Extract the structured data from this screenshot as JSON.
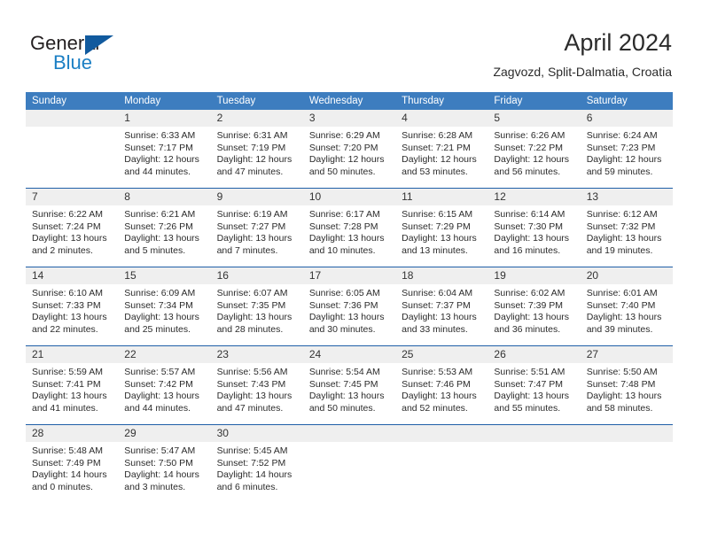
{
  "brand": {
    "name_part1": "General",
    "name_part2": "Blue",
    "accent_color": "#1b7fc4",
    "triangle_color": "#115a9e"
  },
  "header": {
    "title": "April 2024",
    "subtitle": "Zagvozd, Split-Dalmatia, Croatia"
  },
  "theme": {
    "header_bg": "#3d7dbf",
    "rule_color": "#1f5fa8",
    "datestrip_bg": "#efefef"
  },
  "weekdays": [
    "Sunday",
    "Monday",
    "Tuesday",
    "Wednesday",
    "Thursday",
    "Friday",
    "Saturday"
  ],
  "weeks": [
    {
      "days": [
        {
          "num": "",
          "lines": []
        },
        {
          "num": "1",
          "lines": [
            "Sunrise: 6:33 AM",
            "Sunset: 7:17 PM",
            "Daylight: 12 hours",
            "and 44 minutes."
          ]
        },
        {
          "num": "2",
          "lines": [
            "Sunrise: 6:31 AM",
            "Sunset: 7:19 PM",
            "Daylight: 12 hours",
            "and 47 minutes."
          ]
        },
        {
          "num": "3",
          "lines": [
            "Sunrise: 6:29 AM",
            "Sunset: 7:20 PM",
            "Daylight: 12 hours",
            "and 50 minutes."
          ]
        },
        {
          "num": "4",
          "lines": [
            "Sunrise: 6:28 AM",
            "Sunset: 7:21 PM",
            "Daylight: 12 hours",
            "and 53 minutes."
          ]
        },
        {
          "num": "5",
          "lines": [
            "Sunrise: 6:26 AM",
            "Sunset: 7:22 PM",
            "Daylight: 12 hours",
            "and 56 minutes."
          ]
        },
        {
          "num": "6",
          "lines": [
            "Sunrise: 6:24 AM",
            "Sunset: 7:23 PM",
            "Daylight: 12 hours",
            "and 59 minutes."
          ]
        }
      ]
    },
    {
      "days": [
        {
          "num": "7",
          "lines": [
            "Sunrise: 6:22 AM",
            "Sunset: 7:24 PM",
            "Daylight: 13 hours",
            "and 2 minutes."
          ]
        },
        {
          "num": "8",
          "lines": [
            "Sunrise: 6:21 AM",
            "Sunset: 7:26 PM",
            "Daylight: 13 hours",
            "and 5 minutes."
          ]
        },
        {
          "num": "9",
          "lines": [
            "Sunrise: 6:19 AM",
            "Sunset: 7:27 PM",
            "Daylight: 13 hours",
            "and 7 minutes."
          ]
        },
        {
          "num": "10",
          "lines": [
            "Sunrise: 6:17 AM",
            "Sunset: 7:28 PM",
            "Daylight: 13 hours",
            "and 10 minutes."
          ]
        },
        {
          "num": "11",
          "lines": [
            "Sunrise: 6:15 AM",
            "Sunset: 7:29 PM",
            "Daylight: 13 hours",
            "and 13 minutes."
          ]
        },
        {
          "num": "12",
          "lines": [
            "Sunrise: 6:14 AM",
            "Sunset: 7:30 PM",
            "Daylight: 13 hours",
            "and 16 minutes."
          ]
        },
        {
          "num": "13",
          "lines": [
            "Sunrise: 6:12 AM",
            "Sunset: 7:32 PM",
            "Daylight: 13 hours",
            "and 19 minutes."
          ]
        }
      ]
    },
    {
      "days": [
        {
          "num": "14",
          "lines": [
            "Sunrise: 6:10 AM",
            "Sunset: 7:33 PM",
            "Daylight: 13 hours",
            "and 22 minutes."
          ]
        },
        {
          "num": "15",
          "lines": [
            "Sunrise: 6:09 AM",
            "Sunset: 7:34 PM",
            "Daylight: 13 hours",
            "and 25 minutes."
          ]
        },
        {
          "num": "16",
          "lines": [
            "Sunrise: 6:07 AM",
            "Sunset: 7:35 PM",
            "Daylight: 13 hours",
            "and 28 minutes."
          ]
        },
        {
          "num": "17",
          "lines": [
            "Sunrise: 6:05 AM",
            "Sunset: 7:36 PM",
            "Daylight: 13 hours",
            "and 30 minutes."
          ]
        },
        {
          "num": "18",
          "lines": [
            "Sunrise: 6:04 AM",
            "Sunset: 7:37 PM",
            "Daylight: 13 hours",
            "and 33 minutes."
          ]
        },
        {
          "num": "19",
          "lines": [
            "Sunrise: 6:02 AM",
            "Sunset: 7:39 PM",
            "Daylight: 13 hours",
            "and 36 minutes."
          ]
        },
        {
          "num": "20",
          "lines": [
            "Sunrise: 6:01 AM",
            "Sunset: 7:40 PM",
            "Daylight: 13 hours",
            "and 39 minutes."
          ]
        }
      ]
    },
    {
      "days": [
        {
          "num": "21",
          "lines": [
            "Sunrise: 5:59 AM",
            "Sunset: 7:41 PM",
            "Daylight: 13 hours",
            "and 41 minutes."
          ]
        },
        {
          "num": "22",
          "lines": [
            "Sunrise: 5:57 AM",
            "Sunset: 7:42 PM",
            "Daylight: 13 hours",
            "and 44 minutes."
          ]
        },
        {
          "num": "23",
          "lines": [
            "Sunrise: 5:56 AM",
            "Sunset: 7:43 PM",
            "Daylight: 13 hours",
            "and 47 minutes."
          ]
        },
        {
          "num": "24",
          "lines": [
            "Sunrise: 5:54 AM",
            "Sunset: 7:45 PM",
            "Daylight: 13 hours",
            "and 50 minutes."
          ]
        },
        {
          "num": "25",
          "lines": [
            "Sunrise: 5:53 AM",
            "Sunset: 7:46 PM",
            "Daylight: 13 hours",
            "and 52 minutes."
          ]
        },
        {
          "num": "26",
          "lines": [
            "Sunrise: 5:51 AM",
            "Sunset: 7:47 PM",
            "Daylight: 13 hours",
            "and 55 minutes."
          ]
        },
        {
          "num": "27",
          "lines": [
            "Sunrise: 5:50 AM",
            "Sunset: 7:48 PM",
            "Daylight: 13 hours",
            "and 58 minutes."
          ]
        }
      ]
    },
    {
      "days": [
        {
          "num": "28",
          "lines": [
            "Sunrise: 5:48 AM",
            "Sunset: 7:49 PM",
            "Daylight: 14 hours",
            "and 0 minutes."
          ]
        },
        {
          "num": "29",
          "lines": [
            "Sunrise: 5:47 AM",
            "Sunset: 7:50 PM",
            "Daylight: 14 hours",
            "and 3 minutes."
          ]
        },
        {
          "num": "30",
          "lines": [
            "Sunrise: 5:45 AM",
            "Sunset: 7:52 PM",
            "Daylight: 14 hours",
            "and 6 minutes."
          ]
        },
        {
          "num": "",
          "lines": []
        },
        {
          "num": "",
          "lines": []
        },
        {
          "num": "",
          "lines": []
        },
        {
          "num": "",
          "lines": []
        }
      ]
    }
  ]
}
